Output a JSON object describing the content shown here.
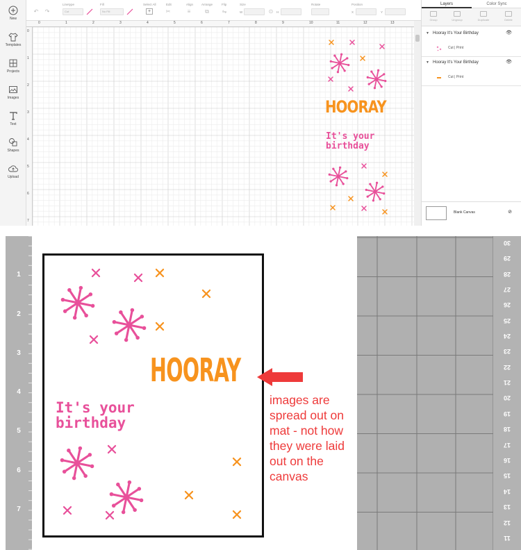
{
  "design_space": {
    "nav": [
      {
        "label": "New",
        "icon": "plus-circle-icon"
      },
      {
        "label": "Templates",
        "icon": "shirt-icon"
      },
      {
        "label": "Projects",
        "icon": "grid-icon"
      },
      {
        "label": "Images",
        "icon": "image-icon"
      },
      {
        "label": "Text",
        "icon": "text-icon"
      },
      {
        "label": "Shapes",
        "icon": "shapes-icon"
      },
      {
        "label": "Upload",
        "icon": "cloud-upload-icon"
      }
    ],
    "toolbar": {
      "linetype_label": "Linetype",
      "linetype_value": "Cut",
      "fill_label": "Fill",
      "fill_value": "No Fill",
      "select_all_label": "Select All",
      "edit_label": "Edit",
      "align_label": "Align",
      "arrange_label": "Arrange",
      "flip_label": "Flip",
      "size_label": "Size",
      "size_w": "W",
      "size_h": "H",
      "rotate_label": "Rotate",
      "position_label": "Position",
      "position_x": "X",
      "position_y": "Y"
    },
    "ruler_top": [
      "0",
      "1",
      "2",
      "3",
      "4",
      "5",
      "6",
      "7",
      "8",
      "9",
      "10",
      "11",
      "12",
      "13"
    ],
    "ruler_left": [
      "0",
      "1",
      "2",
      "3",
      "4",
      "5",
      "6",
      "7"
    ],
    "layers_panel": {
      "tab_layers": "Layers",
      "tab_color_sync": "Color Sync",
      "actions": [
        "Group",
        "Ungroup",
        "Duplicate",
        "Delete"
      ],
      "groups": [
        {
          "name": "Hooray It's Your Birthday",
          "ops": "Cut  |  Print"
        },
        {
          "name": "Hooray It's Your Birthday",
          "ops": "Cut  |  Print"
        }
      ],
      "blank_canvas": "Blank Canvas"
    },
    "design": {
      "hooray": "HOORAY",
      "bday_line1": "It's your",
      "bday_line2": "birthday"
    }
  },
  "mat": {
    "left_ruler": [
      "1",
      "2",
      "3",
      "4",
      "5",
      "6",
      "7"
    ],
    "right_ruler": [
      "30",
      "29",
      "28",
      "27",
      "26",
      "25",
      "24",
      "23",
      "22",
      "21",
      "20",
      "19",
      "18",
      "17",
      "16",
      "15",
      "14",
      "13",
      "12",
      "11"
    ],
    "hooray": "HOORAY",
    "bday_line1": "It's your",
    "bday_line2": "birthday",
    "annotation": "images are spread out on mat - not how they were laid out on the canvas"
  },
  "colors": {
    "pink": "#e8509a",
    "orange": "#f7931e",
    "annotation_red": "#ee3a3a",
    "mat_gray": "#b0b0b0"
  }
}
